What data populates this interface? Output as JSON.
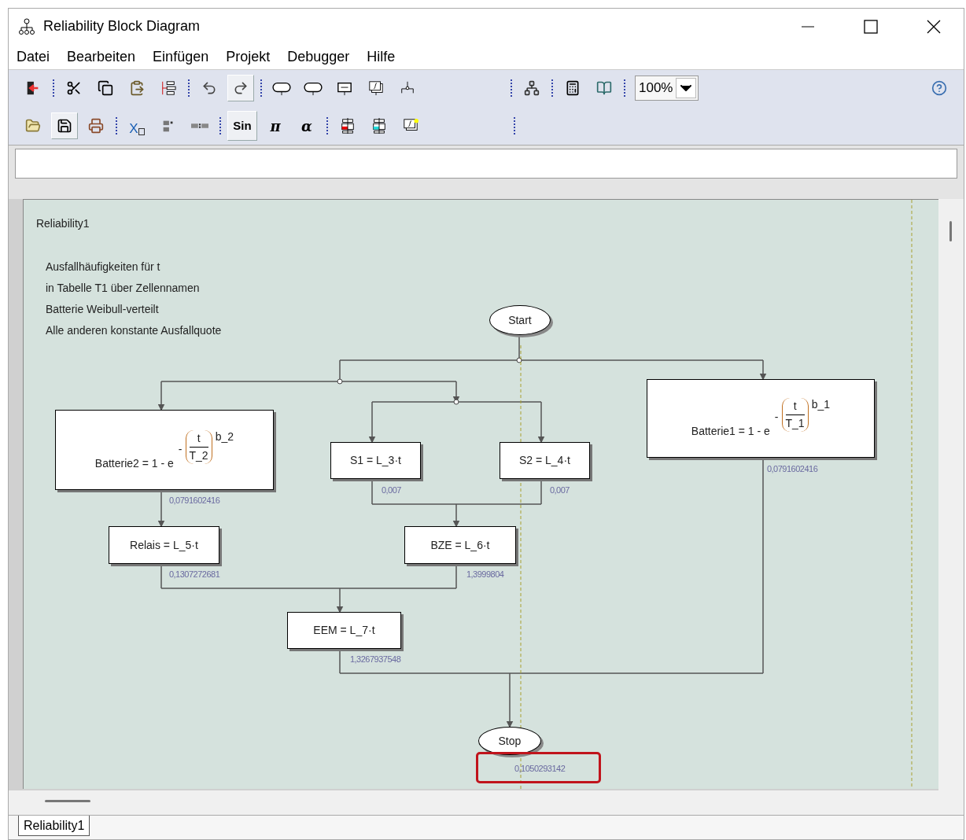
{
  "window": {
    "title": "Reliability Block Diagram"
  },
  "menu": [
    "Datei",
    "Bearbeiten",
    "Einfügen",
    "Projekt",
    "Debugger",
    "Hilfe"
  ],
  "toolbar": {
    "rows": [
      [
        {
          "kind": "icon",
          "pressed": false
        },
        {
          "kind": "separator"
        },
        {
          "kind": "icon",
          "pressed": false
        },
        {
          "kind": "icon",
          "pressed": false
        },
        {
          "kind": "icon",
          "pressed": false
        },
        {
          "kind": "icon",
          "pressed": false
        },
        {
          "kind": "separator"
        },
        {
          "kind": "icon",
          "pressed": false
        },
        {
          "kind": "icon",
          "pressed": true
        },
        {
          "kind": "separator"
        },
        {
          "kind": "icon",
          "pressed": false
        },
        {
          "kind": "icon",
          "pressed": false
        },
        {
          "kind": "icon",
          "pressed": false
        },
        {
          "kind": "icon",
          "pressed": false
        },
        {
          "kind": "icon",
          "pressed": false
        },
        {
          "kind": "gap"
        },
        {
          "kind": "separator"
        },
        {
          "kind": "icon",
          "pressed": false
        },
        {
          "kind": "separator"
        },
        {
          "kind": "icon",
          "pressed": false
        },
        {
          "kind": "icon",
          "pressed": false
        },
        {
          "kind": "separator"
        },
        {
          "kind": "zoom",
          "label": "100%"
        },
        {
          "kind": "fill"
        },
        {
          "kind": "icon",
          "pressed": false
        }
      ],
      [
        {
          "kind": "icon",
          "pressed": false
        },
        {
          "kind": "icon",
          "pressed": true
        },
        {
          "kind": "icon",
          "pressed": false
        },
        {
          "kind": "separator"
        },
        {
          "kind": "subscript",
          "label": "X",
          "pressed": false
        },
        {
          "kind": "icon",
          "pressed": false
        },
        {
          "kind": "icon",
          "pressed": false
        },
        {
          "kind": "separator"
        },
        {
          "kind": "text",
          "label": "Sin",
          "pressed": true
        },
        {
          "kind": "symbol",
          "label": "π",
          "pressed": false
        },
        {
          "kind": "symbol",
          "label": "α",
          "pressed": false
        },
        {
          "kind": "separator"
        },
        {
          "kind": "icon",
          "pressed": false
        },
        {
          "kind": "icon",
          "pressed": false
        },
        {
          "kind": "icon",
          "pressed": false
        },
        {
          "kind": "gap"
        },
        {
          "kind": "separator"
        }
      ]
    ]
  },
  "diagram": {
    "title": "Reliability1",
    "note": [
      "Ausfallhäufigkeiten für t",
      "in Tabelle T1 über Zellennamen",
      "Batterie Weibull-verteilt",
      "Alle anderen konstante Ausfallquote"
    ],
    "nodes": [
      {
        "kind": "terminal",
        "label": "Start"
      },
      {
        "kind": "weibull",
        "label": "Batterie2 = 1 - e",
        "sign": "-",
        "numerator": "t",
        "denominator": "T_2",
        "power": "b_2",
        "value": "0,0791602416"
      },
      {
        "kind": "block",
        "label": "S1 = L_3·t",
        "value": "0,007"
      },
      {
        "kind": "block",
        "label": "S2 = L_4·t",
        "value": "0,007"
      },
      {
        "kind": "weibull",
        "label": "Batterie1 = 1 - e",
        "sign": "-",
        "numerator": "t",
        "denominator": "T_1",
        "power": "b_1",
        "value": "0,0791602416"
      },
      {
        "kind": "block",
        "label": "Relais = L_5·t",
        "value": "0,1307272681"
      },
      {
        "kind": "block",
        "label": "BZE = L_6·t",
        "value": "1,3999804"
      },
      {
        "kind": "block",
        "label": "EEM = L_7·t",
        "value": "1,3267937548"
      },
      {
        "kind": "terminal",
        "label": "Stop",
        "value": "0,1050293142",
        "highlighted": true
      }
    ]
  },
  "tabs": [
    {
      "label": "Reliability1",
      "selected": true
    }
  ]
}
